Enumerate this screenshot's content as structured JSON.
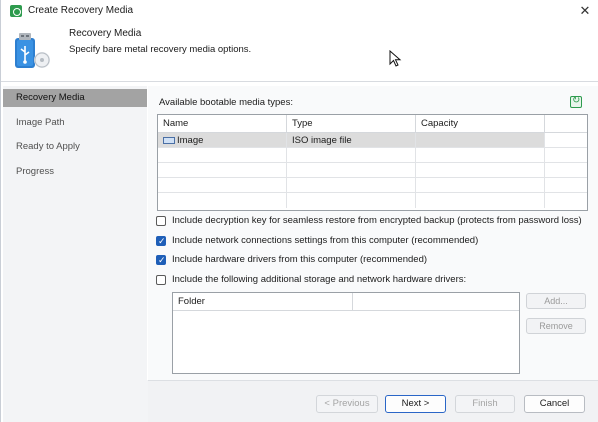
{
  "window": {
    "title": "Create Recovery Media",
    "close_glyph": "✕"
  },
  "header": {
    "title": "Recovery Media",
    "subtitle": "Specify bare metal recovery media options.",
    "icon": "usb-icon"
  },
  "nav": {
    "items": [
      {
        "label": "Recovery Media",
        "active": true
      },
      {
        "label": "Image Path",
        "active": false
      },
      {
        "label": "Ready to Apply",
        "active": false
      },
      {
        "label": "Progress",
        "active": false
      }
    ]
  },
  "media": {
    "label": "Available bootable media types:",
    "refresh_icon": "refresh-icon",
    "columns": [
      "Name",
      "Type",
      "Capacity"
    ],
    "rows": [
      {
        "name": "Image",
        "type": "ISO image file",
        "capacity": ""
      }
    ]
  },
  "options": [
    {
      "label": "Include decryption key for seamless restore from encrypted backup (protects from password loss)",
      "checked": false
    },
    {
      "label": "Include network connections settings from this computer (recommended)",
      "checked": true
    },
    {
      "label": "Include hardware drivers from this computer (recommended)",
      "checked": true
    },
    {
      "label": "Include the following additional storage and network hardware drivers:",
      "checked": false
    }
  ],
  "drivers": {
    "column": "Folder",
    "add_label": "Add...",
    "remove_label": "Remove"
  },
  "footer": {
    "previous_label": "< Previous",
    "next_label": "Next >",
    "finish_label": "Finish",
    "cancel_label": "Cancel"
  },
  "colors": {
    "accent": "#1f5fb8",
    "brand_green": "#2e9b4e",
    "nav_selected": "#a3a3a3"
  }
}
